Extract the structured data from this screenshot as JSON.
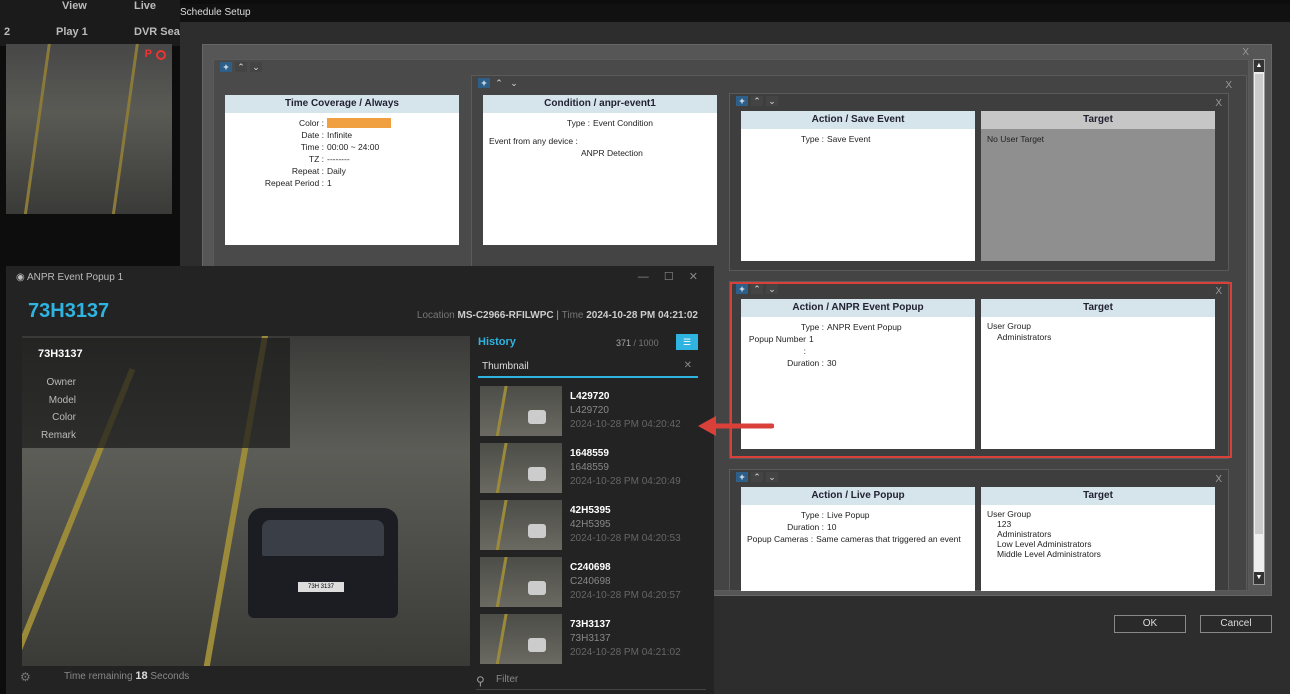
{
  "bg": {
    "tab_view": "View",
    "tab_live": "Live",
    "tab_play": "Play 1",
    "tab_dvr": "DVR Search",
    "tab_num": "2",
    "rec_p": "P"
  },
  "schedule": {
    "title": "Schedule Setup",
    "close_x": "X",
    "time_card": {
      "title": "Time Coverage / Always",
      "color_label": "Color :",
      "color_value": "#f0a040",
      "date_label": "Date :",
      "date_value": "Infinite",
      "time_label": "Time :",
      "time_value": "00:00 ~ 24:00",
      "tz_label": "TZ :",
      "tz_value": "--------",
      "repeat_label": "Repeat :",
      "repeat_value": "Daily",
      "period_label": "Repeat Period :",
      "period_value": "1"
    },
    "condition_card": {
      "title": "Condition / anpr-event1",
      "type_label": "Type :",
      "type_value": "Event Condition",
      "event_label": "Event from any device :",
      "event_value": "ANPR Detection"
    },
    "action1": {
      "title": "Action / Save Event",
      "type_label": "Type :",
      "type_value": "Save Event",
      "target_title": "Target",
      "target_value": "No User Target"
    },
    "action2": {
      "title": "Action / ANPR Event Popup",
      "type_label": "Type :",
      "type_value": "ANPR Event Popup",
      "popup_label": "Popup Number :",
      "popup_value": "1",
      "duration_label": "Duration :",
      "duration_value": "30",
      "target_title": "Target",
      "target_group": "User Group",
      "target_1": "Administrators"
    },
    "action3": {
      "title": "Action / Live Popup",
      "type_label": "Type :",
      "type_value": "Live Popup",
      "duration_label": "Duration :",
      "duration_value": "10",
      "cameras_label": "Popup Cameras :",
      "cameras_value": "Same cameras that triggered an event",
      "target_title": "Target",
      "target_group": "User Group",
      "target_1": "123",
      "target_2": "Administrators",
      "target_3": "Low Level Administrators",
      "target_4": "Middle Level Administrators"
    },
    "ok": "OK",
    "cancel": "Cancel"
  },
  "popup": {
    "title": "ANPR Event Popup 1",
    "plate": "73H3137",
    "location_label": "Location",
    "location_value": "MS-C2966-RFILWPC",
    "time_label": "Time",
    "time_value": "2024-10-28 PM 04:21:02",
    "overlay_plate": "73H3137",
    "owner": "Owner",
    "model": "Model",
    "color": "Color",
    "remark": "Remark",
    "lp_text": "73H 3137",
    "history_label": "History",
    "history_count": "371",
    "history_total": "/ 1000",
    "thumbnail_label": "Thumbnail",
    "filter_placeholder": "Filter",
    "time_remaining_label": "Time remaining",
    "time_remaining_value": "18",
    "seconds": "Seconds",
    "history": [
      {
        "plate": "L429720",
        "sub": "L429720",
        "time": "2024-10-28 PM 04:20:42"
      },
      {
        "plate": "1648559",
        "sub": "1648559",
        "time": "2024-10-28 PM 04:20:49"
      },
      {
        "plate": "42H5395",
        "sub": "42H5395",
        "time": "2024-10-28 PM 04:20:53"
      },
      {
        "plate": "C240698",
        "sub": "C240698",
        "time": "2024-10-28 PM 04:20:57"
      },
      {
        "plate": "73H3137",
        "sub": "73H3137",
        "time": "2024-10-28 PM 04:21:02"
      }
    ]
  },
  "colors": {
    "accent": "#2fb3e0",
    "highlight": "#d9403a"
  }
}
